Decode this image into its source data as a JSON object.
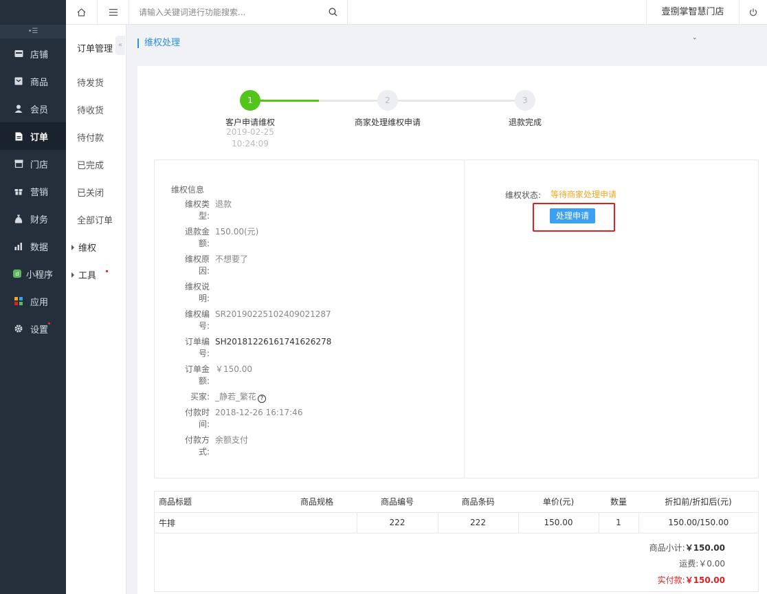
{
  "leftnav": {
    "collapse_icon": "menu-collapse-icon",
    "items": [
      {
        "label": "店铺",
        "icon": "store-icon"
      },
      {
        "label": "商品",
        "icon": "goods-icon"
      },
      {
        "label": "会员",
        "icon": "user-icon"
      },
      {
        "label": "订单",
        "icon": "order-icon",
        "active": true
      },
      {
        "label": "门店",
        "icon": "shop-icon"
      },
      {
        "label": "营销",
        "icon": "gift-icon"
      },
      {
        "label": "财务",
        "icon": "money-bag-icon"
      },
      {
        "label": "数据",
        "icon": "bar-chart-icon"
      },
      {
        "label": "小程序",
        "icon": "mini-program-icon"
      },
      {
        "label": "应用",
        "icon": "apps-icon"
      },
      {
        "label": "设置",
        "icon": "gear-icon"
      }
    ]
  },
  "topbar": {
    "search_placeholder": "请输入关键词进行功能搜索...",
    "store_name": "壹捌掌智慧门店"
  },
  "subnav": {
    "title": "订单管理",
    "items": [
      "待发货",
      "待收货",
      "待付款",
      "已完成",
      "已关闭",
      "全部订单"
    ],
    "groups": [
      "维权",
      "工具"
    ]
  },
  "breadcrumb": "维权处理",
  "steps": [
    {
      "num": "1",
      "label": "客户申请维权",
      "date": "2019-02-25",
      "time": "10:24:09"
    },
    {
      "num": "2",
      "label": "商家处理维权申请"
    },
    {
      "num": "3",
      "label": "退款完成"
    }
  ],
  "info": {
    "title": "维权信息",
    "fields": [
      {
        "k1": "维权类",
        "k2": "型:",
        "v": "退款"
      },
      {
        "k1": "退款金",
        "k2": "额:",
        "v": "150.00(元)"
      },
      {
        "k1": "维权原",
        "k2": "因:",
        "v": "不想要了"
      },
      {
        "k1": "维权说",
        "k2": "明:",
        "v": ""
      },
      {
        "k1": "维权编",
        "k2": "号:",
        "v": "SR20190225102409021287"
      },
      {
        "k1": "订单编",
        "k2": "号:",
        "v": "SH20181226161741626278"
      },
      {
        "k1": "订单金",
        "k2": "额:",
        "v": "￥150.00"
      },
      {
        "k1": "买家:",
        "k2": "",
        "v": "_静若_繁花"
      },
      {
        "k1": "付款时",
        "k2": "间:",
        "v": "2018-12-26 16:17:46"
      },
      {
        "k1": "付款方",
        "k2": "式:",
        "v": "余额支付"
      }
    ],
    "status_label": "维权状态:",
    "status_value": "等待商家处理申请",
    "process_button": "处理申请"
  },
  "table": {
    "headers": [
      "商品标题",
      "商品规格",
      "商品编号",
      "商品条码",
      "单价(元)",
      "数量",
      "折扣前/折扣后(元)"
    ],
    "rows": [
      [
        "牛排",
        "",
        "222",
        "222",
        "150.00",
        "1",
        "150.00/150.00"
      ]
    ],
    "subtotal_label": "商品小计:",
    "subtotal_value": "￥150.00",
    "shipping_label": "运费:",
    "shipping_value": "￥0.00",
    "paid_label": "实付款:",
    "paid_value": "￥150.00"
  },
  "colors": {
    "accent": "#2d8cf0",
    "step_active": "#52c41a",
    "status_warning": "#f5a623",
    "alert_red": "#e02020",
    "nav_bg": "#252f3c"
  }
}
